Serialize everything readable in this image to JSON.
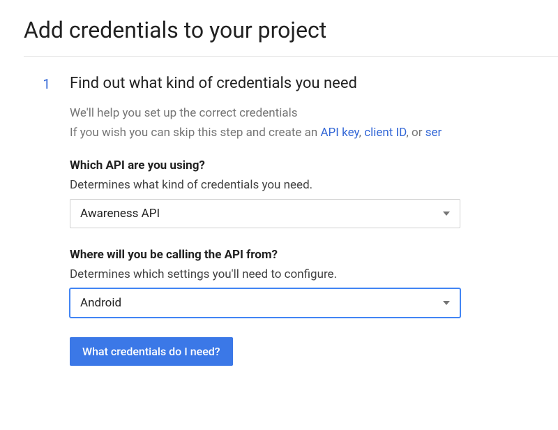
{
  "page_title": "Add credentials to your project",
  "step": {
    "number": "1",
    "title": "Find out what kind of credentials you need",
    "help_line_1": "We'll help you set up the correct credentials",
    "help_line_2_prefix": "If you wish you can skip this step and create an ",
    "help_link_api_key": "API key",
    "help_comma_1": ", ",
    "help_link_client_id": "client ID",
    "help_comma_2": ", or ",
    "help_link_service": "ser"
  },
  "field_api": {
    "label": "Which API are you using?",
    "desc": "Determines what kind of credentials you need.",
    "value": "Awareness API"
  },
  "field_calling_from": {
    "label": "Where will you be calling the API from?",
    "desc": "Determines which settings you'll need to configure.",
    "value": "Android"
  },
  "button_label": "What credentials do I need?"
}
